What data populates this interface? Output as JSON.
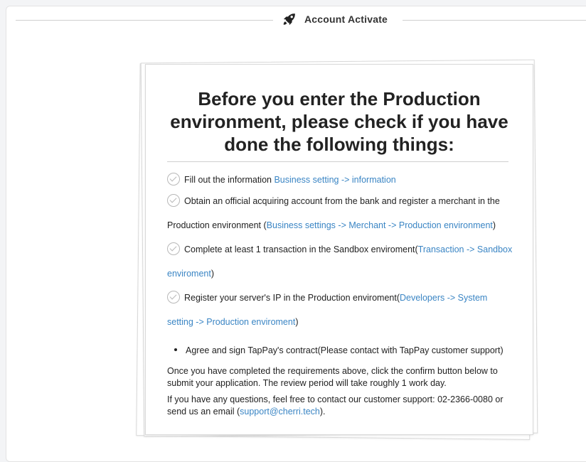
{
  "header": {
    "title": "Account Activate",
    "icon": "rocket-icon"
  },
  "card": {
    "title": "Before you enter the Production environment, please check if you have done the following things:",
    "requirements": [
      {
        "text": "Fill out the information ",
        "link": "Business setting -> information",
        "suffix": ""
      },
      {
        "text": "Obtain an official acquiring account from the bank and register a merchant in the Production environment (",
        "link": "Business settings -> Merchant -> Production environment",
        "suffix": ")"
      },
      {
        "text": "Complete at least 1 transaction in the Sandbox enviroment(",
        "link": "Transaction -> Sandbox enviroment",
        "suffix": ")"
      },
      {
        "text": "Register your server's IP in the Production enviroment(",
        "link": "Developers -> System setting -> Production enviroment",
        "suffix": ")"
      }
    ],
    "bullet": "Agree and sign TapPay's contract(Please contact with TapPay customer support)",
    "note1": "Once you have completed the requirements above, click the confirm button below to submit your application. The review period will take roughly 1 work day.",
    "note2_prefix": "If you have any questions, feel free to contact our customer support: 02-2366-0080 or send us an email (",
    "note2_link": "support@cherri.tech",
    "note2_suffix": ")."
  },
  "colors": {
    "link": "#3a85c4",
    "background": "#f3f4f6"
  }
}
